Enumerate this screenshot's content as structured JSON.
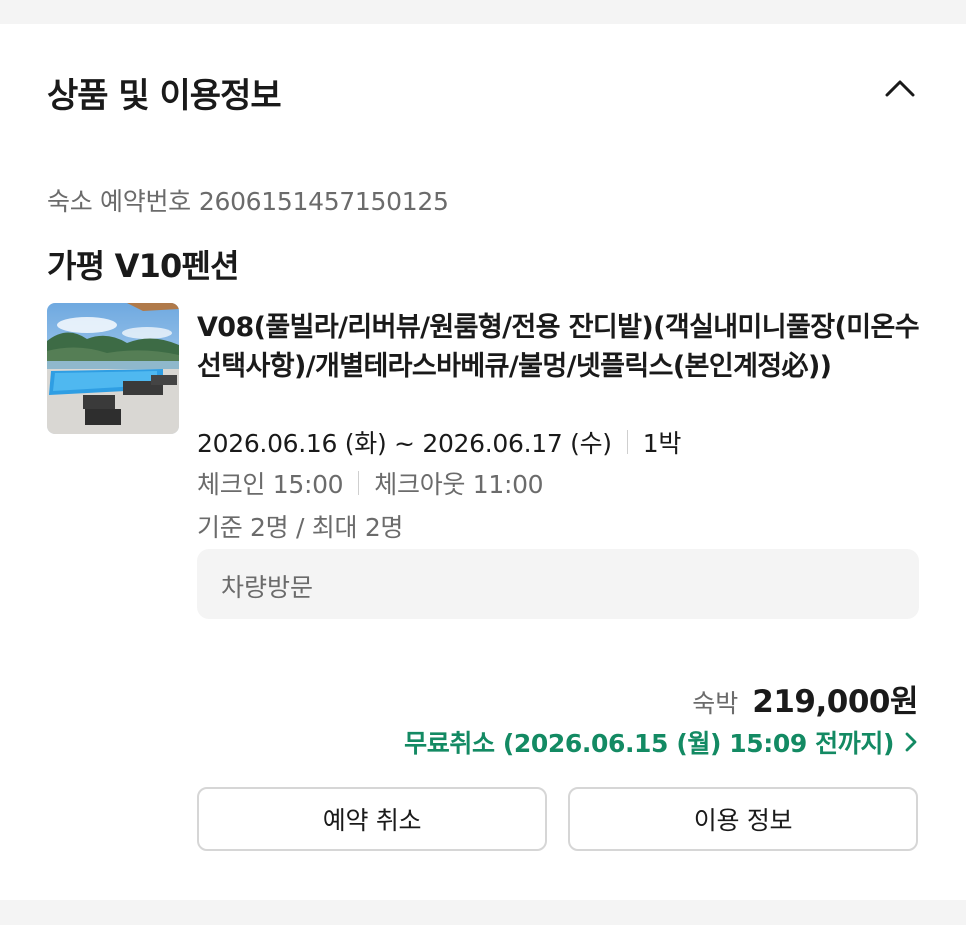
{
  "section": {
    "title": "상품 및 이용정보",
    "collapse_icon": "chevron-up-icon"
  },
  "reservation": {
    "number_label": "숙소 예약번호",
    "number": "2606151457150125"
  },
  "property": {
    "name": "가평 V10펜션"
  },
  "room": {
    "image_icon": "pool-villa-thumbnail",
    "title": "V08(풀빌라/리버뷰/원룸형/전용 잔디밭)(객실내미니풀장(미온수선택사항)/개별테라스바베큐/불멍/넷플릭스(본인계정必))",
    "dates": "2026.06.16 (화) ~ 2026.06.17 (수)",
    "nights": "1박",
    "checkin": "체크인 15:00",
    "checkout": "체크아웃 11:00",
    "capacity": "기준 2명 / 최대 2명",
    "visit_method": "차량방문"
  },
  "price": {
    "label": "숙박",
    "value": "219,000원"
  },
  "cancel_policy": {
    "text": "무료취소 (2026.06.15 (월) 15:09 전까지)",
    "color": "#138a63",
    "icon": "chevron-right-icon"
  },
  "buttons": {
    "cancel_label": "예약 취소",
    "info_label": "이용 정보"
  }
}
